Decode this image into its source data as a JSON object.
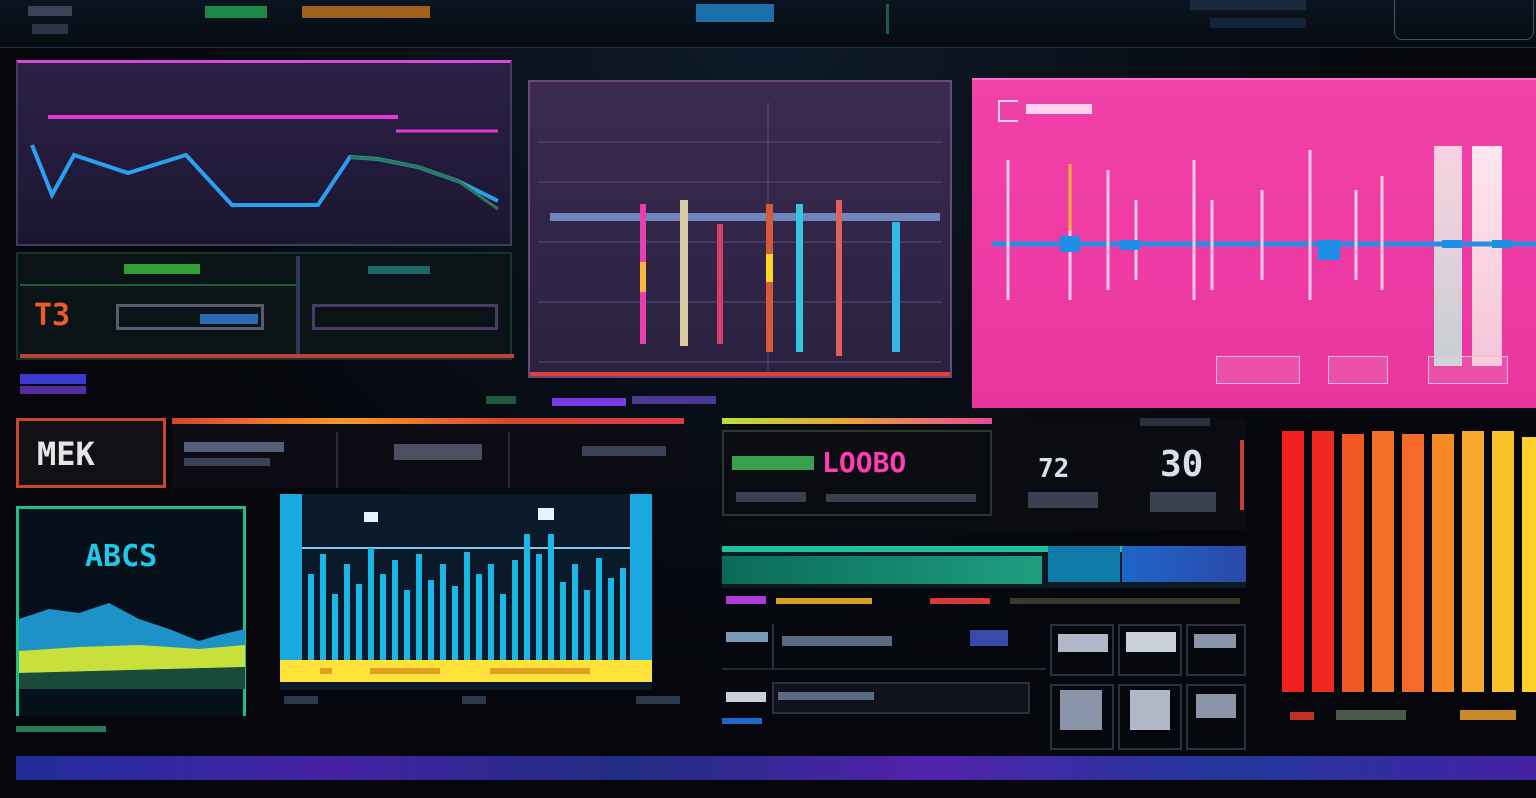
{
  "colors": {
    "magenta": "#ff3fc0",
    "cyan": "#1fb7e6",
    "orange": "#ff7a2a",
    "yellow": "#ffd21f",
    "green": "#29d18b",
    "red": "#ff2a2a",
    "purple": "#8a5cff",
    "pink_panel": "#f03ea9"
  },
  "icons": {
    "corner_icon": "bracket-icon"
  },
  "left_top_panel": {
    "status_left": "T3",
    "status_right": ""
  },
  "center_panel": {
    "title": "",
    "title_right": ""
  },
  "pink_panel": {
    "title_right": "",
    "buttons": [
      "",
      "",
      ""
    ]
  },
  "mid_left": {
    "label": "MEK"
  },
  "abcs_panel": {
    "title": "ABCS"
  },
  "readouts": {
    "main_value": "LOOBO",
    "value_a": "72",
    "value_b": "30"
  },
  "levels": {
    "progress_fraction": 0.37
  },
  "orange_bars": {
    "values": [
      0.98,
      0.98,
      0.97,
      0.98,
      0.97,
      0.97,
      0.98,
      0.98,
      0.96
    ]
  }
}
